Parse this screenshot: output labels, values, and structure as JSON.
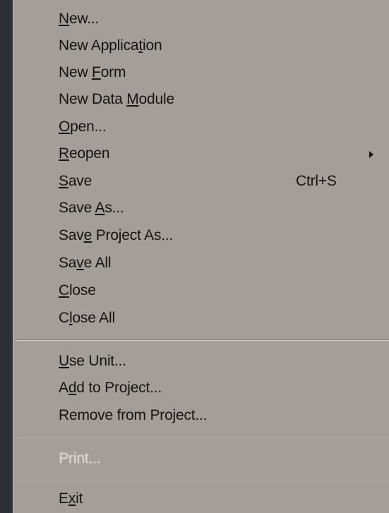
{
  "menu": {
    "items": [
      {
        "pre": "",
        "key": "N",
        "post": "ew..."
      },
      {
        "pre": "New Applica",
        "key": "t",
        "post": "ion"
      },
      {
        "pre": "New ",
        "key": "F",
        "post": "orm"
      },
      {
        "pre": "New Data ",
        "key": "M",
        "post": "odule"
      },
      {
        "pre": "",
        "key": "O",
        "post": "pen..."
      },
      {
        "pre": "",
        "key": "R",
        "post": "eopen"
      },
      {
        "pre": "",
        "key": "S",
        "post": "ave",
        "shortcut": "Ctrl+S"
      },
      {
        "pre": "Save ",
        "key": "A",
        "post": "s..."
      },
      {
        "pre": "Sav",
        "key": "e",
        "post": " Project As..."
      },
      {
        "pre": "Sa",
        "key": "v",
        "post": "e All"
      },
      {
        "pre": "",
        "key": "C",
        "post": "lose"
      },
      {
        "pre": "C",
        "key": "l",
        "post": "ose All"
      },
      {
        "pre": "",
        "key": "U",
        "post": "se Unit..."
      },
      {
        "pre": "A",
        "key": "d",
        "post": "d to Project..."
      },
      {
        "pre": "Remove from Project...",
        "key": "",
        "post": ""
      },
      {
        "pre": "Print...",
        "key": "",
        "post": ""
      },
      {
        "pre": "E",
        "key": "x",
        "post": "it"
      }
    ]
  },
  "colors": {
    "menu_background": "#a39f98",
    "window_background": "#2b2f36",
    "text": "#141414",
    "disabled_text": "#d8d5cf"
  },
  "icons": {
    "submenu_arrow": "chevron-right-icon"
  }
}
